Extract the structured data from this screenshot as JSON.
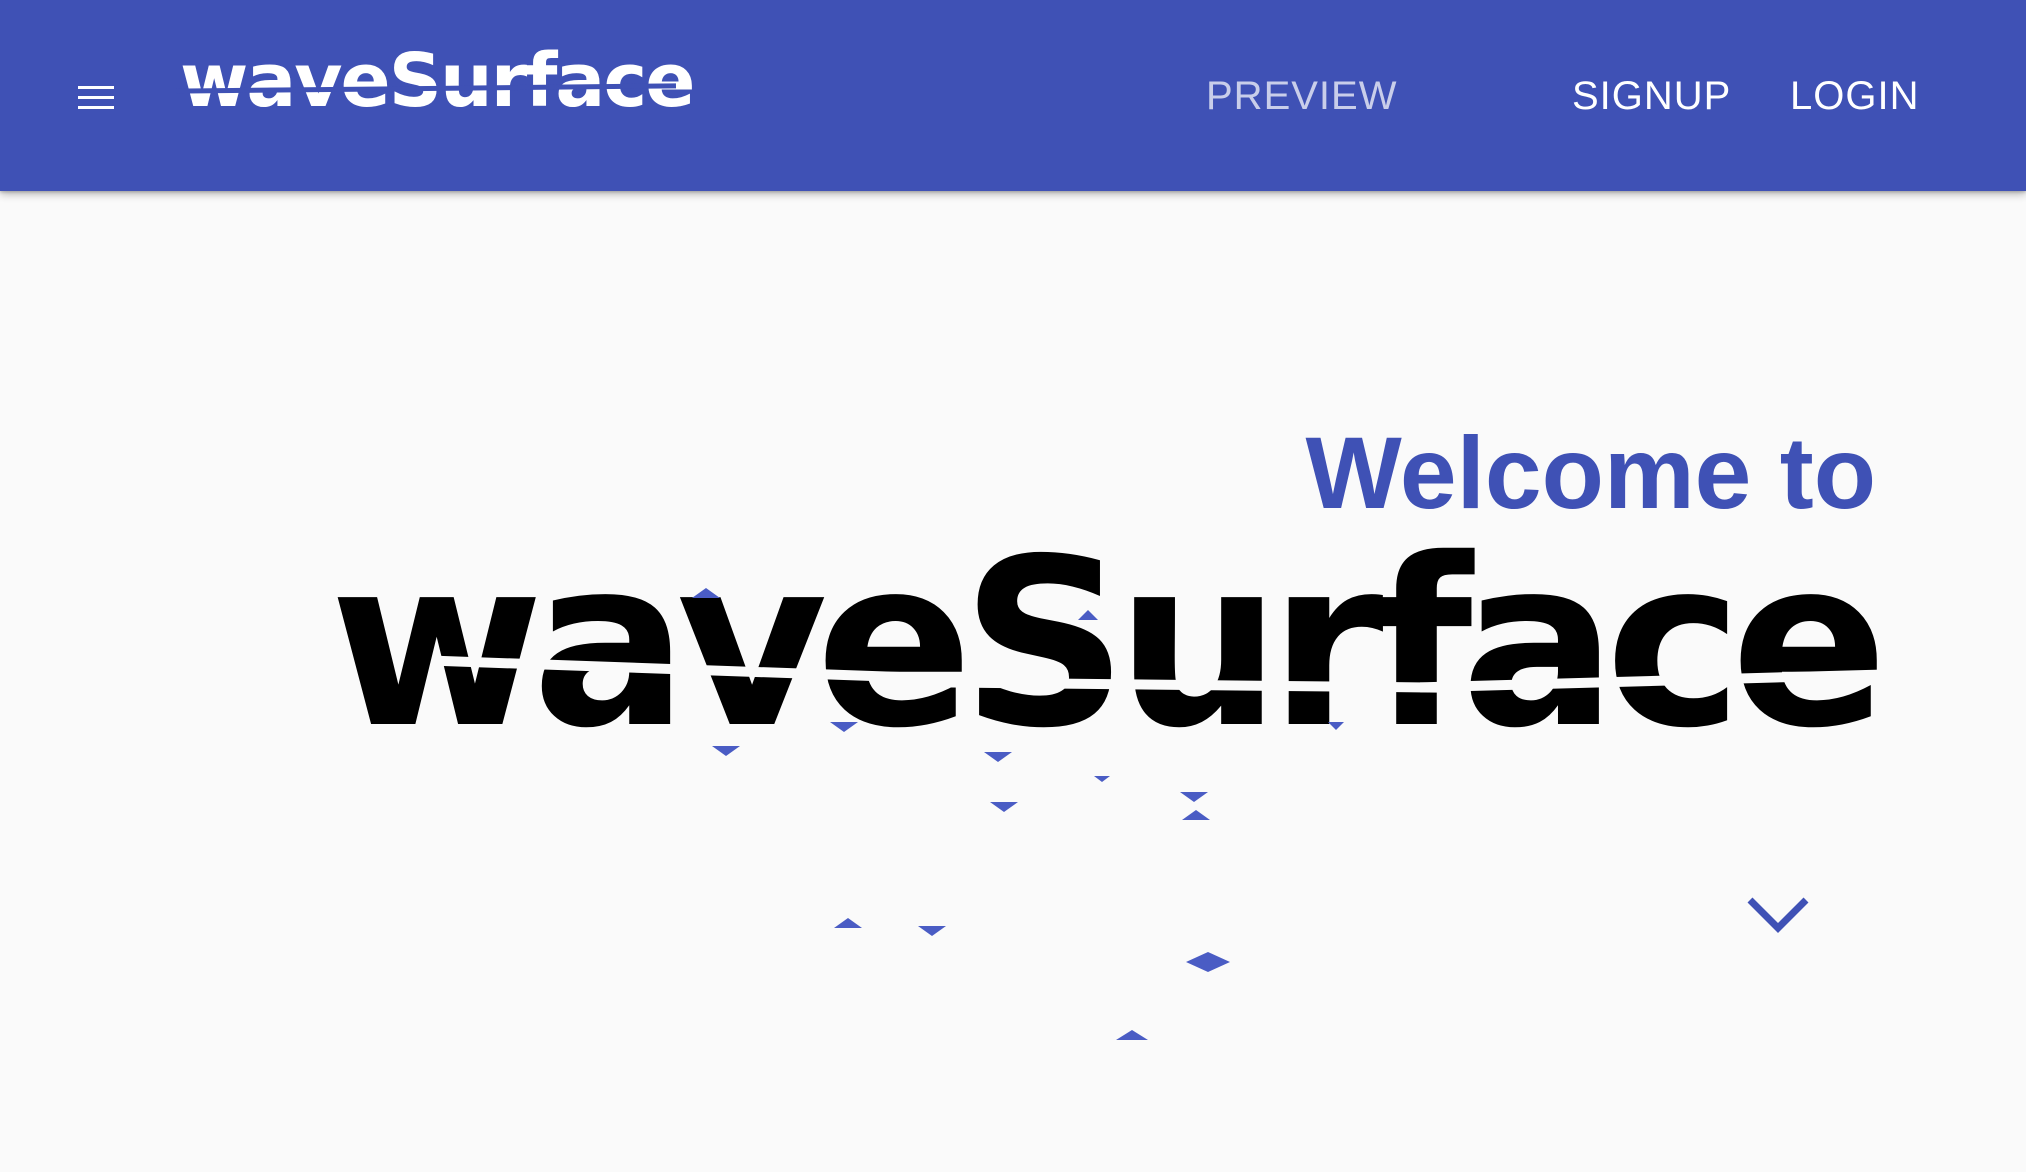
{
  "header": {
    "logo_text": "waveSurface",
    "nav": {
      "preview": "PREVIEW",
      "signup": "SIGNUP",
      "login": "LOGIN"
    },
    "background_color": "#3f51b5"
  },
  "hero": {
    "welcome": "Welcome to",
    "brand": "waveSurface",
    "accent_color": "#3f51b5"
  },
  "icons": {
    "menu": "menu-icon",
    "scroll_down": "chevron-down-icon"
  }
}
